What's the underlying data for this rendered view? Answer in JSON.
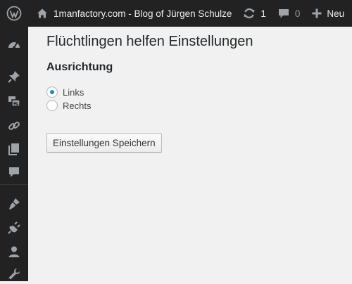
{
  "adminbar": {
    "wp_logo_icon": "wordpress-logo-icon",
    "site_icon": "home-icon",
    "site_name": "1manfactory.com - Blog of Jürgen Schulze",
    "updates_icon": "updates-icon",
    "updates_count": "1",
    "comments_icon": "comment-bubble-icon",
    "comments_count": "0",
    "new_icon": "plus-icon",
    "new_label": "Neu"
  },
  "menu": [
    {
      "icon": "dashboard-icon"
    },
    {
      "icon": "pushpin-icon"
    },
    {
      "icon": "media-icon"
    },
    {
      "icon": "link-icon"
    },
    {
      "icon": "pages-icon"
    },
    {
      "icon": "comments-icon"
    },
    {
      "icon": "appearance-brush-icon"
    },
    {
      "icon": "plugins-icon"
    },
    {
      "icon": "users-icon"
    },
    {
      "icon": "tools-wrench-icon"
    }
  ],
  "page": {
    "title": "Flüchtlingen helfen Einstellungen",
    "section_title": "Ausrichtung",
    "options": [
      {
        "label": "Links",
        "selected": true
      },
      {
        "label": "Rechts",
        "selected": false
      }
    ],
    "save_button": "Einstellungen Speichern"
  },
  "colors": {
    "adminbar_bg": "#222222",
    "content_bg": "#f1f1f1",
    "radio_checked": "#1e8cbe",
    "icon": "#eeeeee"
  }
}
